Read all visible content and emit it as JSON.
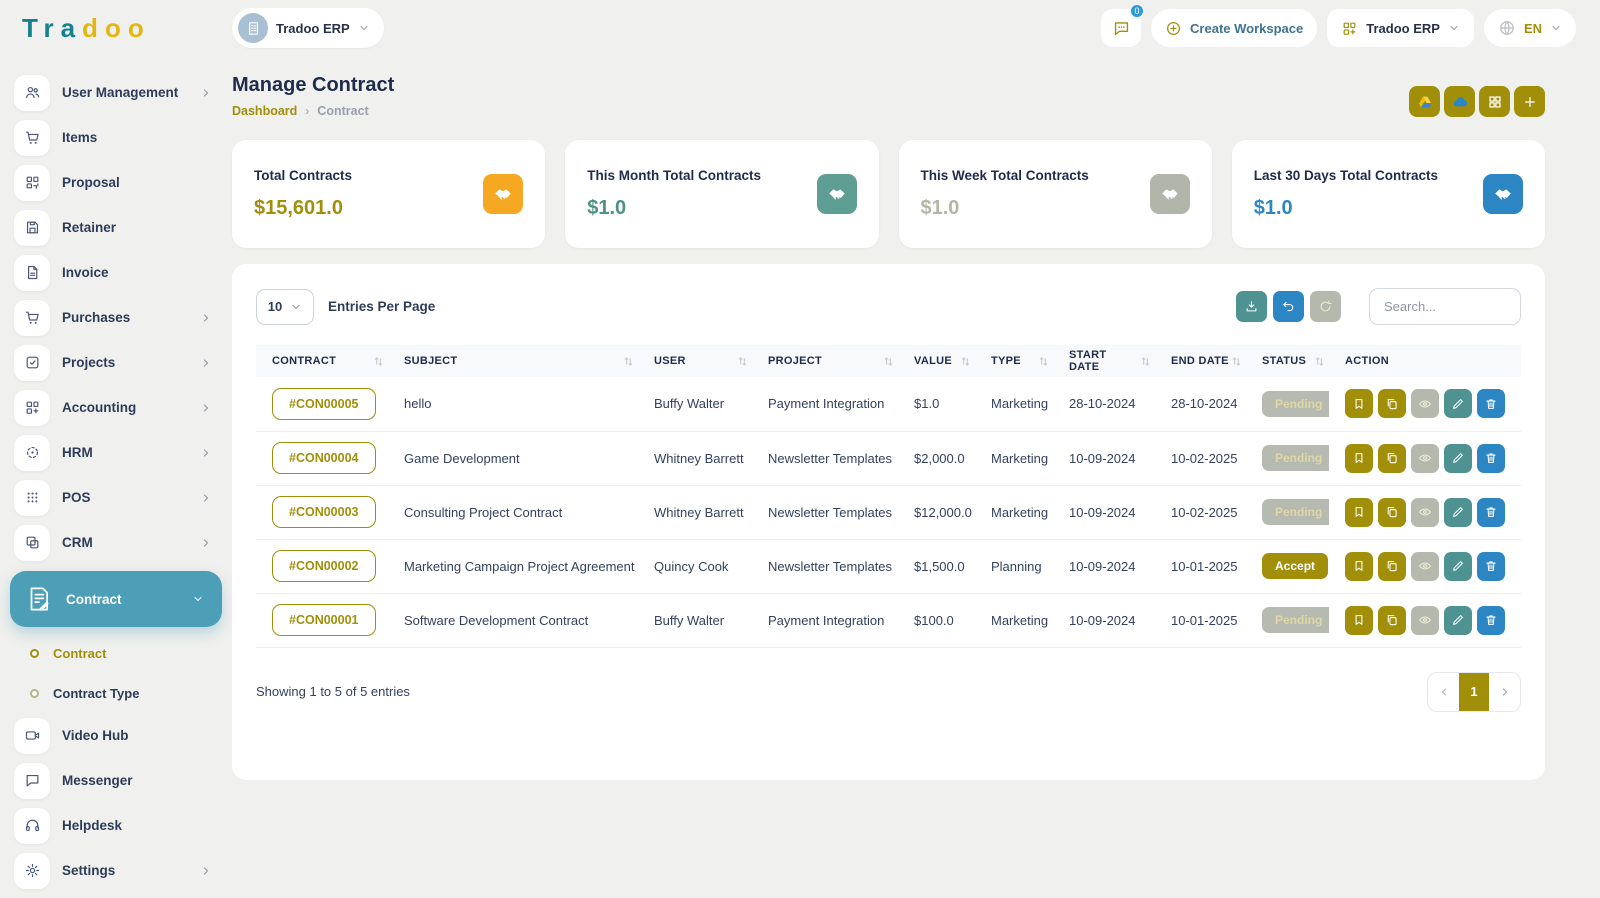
{
  "brand": {
    "letters": [
      {
        "ch": "T",
        "color": "#15818e"
      },
      {
        "ch": "r",
        "color": "#15818e"
      },
      {
        "ch": "a",
        "color": "#15818e"
      },
      {
        "ch": "d",
        "color": "#e3b713"
      },
      {
        "ch": "o",
        "color": "#e3b713"
      },
      {
        "ch": "o",
        "color": "#e3b713"
      }
    ]
  },
  "topbar": {
    "workspace_label": "Tradoo ERP",
    "chat_badge": "0",
    "create_workspace_label": "Create Workspace",
    "erp_button_label": "Tradoo ERP",
    "language": "EN"
  },
  "page_header": {
    "title": "Manage Contract",
    "breadcrumb_home": "Dashboard",
    "breadcrumb_current": "Contract"
  },
  "header_actions": [
    {
      "icon": "drive-icon"
    },
    {
      "icon": "cloud-icon"
    },
    {
      "icon": "grid-icon"
    },
    {
      "icon": "plus-icon"
    }
  ],
  "stats": [
    {
      "label": "Total Contracts",
      "value": "$15,601.0",
      "value_color": "#a18f0a",
      "icon_bg": "#f7a823",
      "icon": "handshake-icon"
    },
    {
      "label": "This Month Total Contracts",
      "value": "$1.0",
      "value_color": "#4e9187",
      "icon_bg": "#5f9e93",
      "icon": "handshake-icon"
    },
    {
      "label": "This Week Total Contracts",
      "value": "$1.0",
      "value_color": "#b4b7a6",
      "icon_bg": "#b2b5aa",
      "icon": "handshake-icon"
    },
    {
      "label": "Last 30 Days Total Contracts",
      "value": "$1.0",
      "value_color": "#2d86c4",
      "icon_bg": "#2d86c4",
      "icon": "handshake-icon"
    }
  ],
  "sidebar": {
    "items": [
      {
        "label": "User Management",
        "icon": "users",
        "chevron": true
      },
      {
        "label": "Items",
        "icon": "cart",
        "chevron": false
      },
      {
        "label": "Proposal",
        "icon": "proposal",
        "chevron": false
      },
      {
        "label": "Retainer",
        "icon": "save",
        "chevron": false
      },
      {
        "label": "Invoice",
        "icon": "file",
        "chevron": false
      },
      {
        "label": "Purchases",
        "icon": "cart",
        "chevron": true
      },
      {
        "label": "Projects",
        "icon": "check-square",
        "chevron": true
      },
      {
        "label": "Accounting",
        "icon": "grid-plus",
        "chevron": true
      },
      {
        "label": "HRM",
        "icon": "crosshair",
        "chevron": true
      },
      {
        "label": "POS",
        "icon": "grid-dots",
        "chevron": true
      },
      {
        "label": "CRM",
        "icon": "copy-squares",
        "chevron": true
      },
      {
        "label": "Contract",
        "icon": "contract",
        "active": true,
        "expanded": true,
        "children": [
          {
            "label": "Contract",
            "active": true
          },
          {
            "label": "Contract Type",
            "active": false
          }
        ]
      },
      {
        "label": "Video Hub",
        "icon": "video",
        "chevron": false
      },
      {
        "label": "Messenger",
        "icon": "chat",
        "chevron": false
      },
      {
        "label": "Helpdesk",
        "icon": "headset",
        "chevron": false
      },
      {
        "label": "Settings",
        "icon": "gear",
        "chevron": true
      }
    ]
  },
  "toolbar": {
    "entries_value": "10",
    "entries_label": "Entries Per Page",
    "search_placeholder": "Search..."
  },
  "table": {
    "columns": [
      "CONTRACT",
      "SUBJECT",
      "USER",
      "PROJECT",
      "VALUE",
      "TYPE",
      "START DATE",
      "END DATE",
      "STATUS",
      "ACTION"
    ],
    "rows": [
      {
        "contract": "#CON00005",
        "subject": "hello",
        "user": "Buffy Walter",
        "project": "Payment Integration",
        "value": "$1.0",
        "type": "Marketing",
        "start_date": "28-10-2024",
        "end_date": "28-10-2024",
        "status": "Pending"
      },
      {
        "contract": "#CON00004",
        "subject": "Game Development",
        "user": "Whitney Barrett",
        "project": "Newsletter Templates",
        "value": "$2,000.0",
        "type": "Marketing",
        "start_date": "10-09-2024",
        "end_date": "10-02-2025",
        "status": "Pending"
      },
      {
        "contract": "#CON00003",
        "subject": "Consulting Project Contract",
        "user": "Whitney Barrett",
        "project": "Newsletter Templates",
        "value": "$12,000.0",
        "type": "Marketing",
        "start_date": "10-09-2024",
        "end_date": "10-02-2025",
        "status": "Pending"
      },
      {
        "contract": "#CON00002",
        "subject": "Marketing Campaign Project Agreement",
        "user": "Quincy Cook",
        "project": "Newsletter Templates",
        "value": "$1,500.0",
        "type": "Planning",
        "start_date": "10-09-2024",
        "end_date": "10-01-2025",
        "status": "Accept"
      },
      {
        "contract": "#CON00001",
        "subject": "Software Development Contract",
        "user": "Buffy Walter",
        "project": "Payment Integration",
        "value": "$100.0",
        "type": "Marketing",
        "start_date": "10-09-2024",
        "end_date": "10-01-2025",
        "status": "Pending"
      }
    ],
    "row_actions": [
      "bookmark",
      "copy",
      "eye",
      "pencil",
      "trash"
    ],
    "footer_text": "Showing 1 to 5 of 5 entries",
    "pagination_current": "1"
  },
  "colors": {
    "accent_olive": "#a18f0a",
    "active_sidebar_teal": "#4d9fb8",
    "button_teal": "#4f9292",
    "button_blue": "#2d86c4",
    "button_gray": "#b5b8ad",
    "stat_orange": "#f7a823",
    "pending_badge_bg": "#b7bab0",
    "accept_badge_bg": "#a18f0a"
  }
}
